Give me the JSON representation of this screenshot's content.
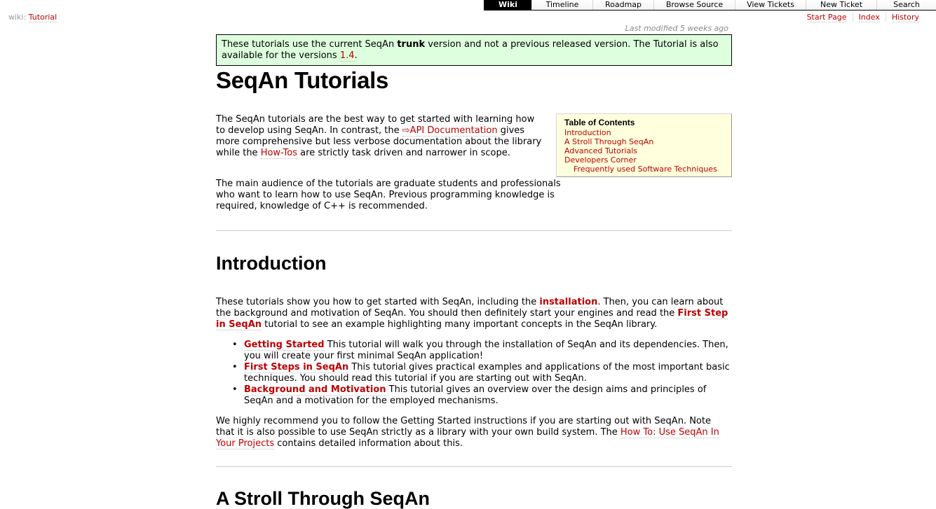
{
  "mainnav": [
    {
      "label": "Wiki",
      "active": true
    },
    {
      "label": "Timeline",
      "active": false
    },
    {
      "label": "Roadmap",
      "active": false
    },
    {
      "label": "Browse Source",
      "active": false
    },
    {
      "label": "View Tickets",
      "active": false
    },
    {
      "label": "New Ticket",
      "active": false
    },
    {
      "label": "Search",
      "active": false
    }
  ],
  "ctxnav": {
    "prefix": "wiki:",
    "page_link": "Tutorial",
    "right": [
      "Start Page",
      "Index",
      "History"
    ]
  },
  "last_modified": "Last modified 5 weeks ago",
  "notice": {
    "t1": "These tutorials use the current SeqAn ",
    "bold": "trunk",
    "t2": " version and not a previous released version. The Tutorial is also available for the versions ",
    "link": "1.4",
    "t3": "."
  },
  "title": "SeqAn Tutorials",
  "intro": {
    "p1_a": "The SeqAn tutorials are the best way to get started with learning how to develop using SeqAn. In contrast, the ",
    "p1_link1": "⇨API Documentation",
    "p1_b": " gives more comprehensive but less verbose documentation about the library while the ",
    "p1_link2": "How-Tos",
    "p1_c": " are strictly task driven and narrower in scope.",
    "p2": "The main audience of the tutorials are graduate students and professionals who want to learn how to use SeqAn. Previous programming knowledge is required, knowledge of C++ is recommended."
  },
  "toc": {
    "title": "Table of Contents",
    "items": [
      "Introduction",
      "A Stroll Through SeqAn",
      "Advanced Tutorials",
      "Developers Corner",
      "Frequently used Software Techniques"
    ]
  },
  "introduction": {
    "heading": "Introduction",
    "p_a": "These tutorials show you how to get started with SeqAn, including the ",
    "p_link1": "installation",
    "p_b": ". Then, you can learn about the background and motivation of SeqAn. You should then definitely start your engines and read the ",
    "p_link2": "First Step in SeqAn",
    "p_c": " tutorial to see an example highlighting many important concepts in the SeqAn library.",
    "bullets": [
      {
        "link": "Getting Started",
        "text": " This tutorial will walk you through the installation of SeqAn and its dependencies. Then, you will create your first minimal SeqAn application!"
      },
      {
        "link": "First Steps in SeqAn",
        "text": " This tutorial gives practical examples and applications of the most important basic techniques. You should read this tutorial if you are starting out with SeqAn."
      },
      {
        "link": "Background and Motivation",
        "text": " This tutorial gives an overview over the design aims and principles of SeqAn and a motivation for the employed mechanisms."
      }
    ],
    "r_a": "We highly recommend you to follow the Getting Started instructions if you are starting out with SeqAn. Note that it is also possible to use SeqAn strictly as a library with your own build system. The ",
    "r_link": "How To: Use SeqAn In Your Projects",
    "r_b": " contains detailed information about this."
  },
  "next_heading": "A Stroll Through SeqAn"
}
